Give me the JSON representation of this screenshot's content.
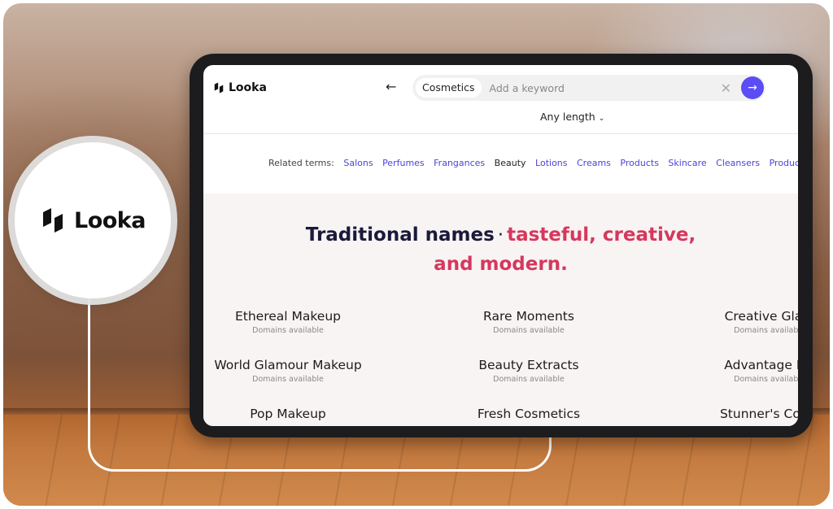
{
  "brand": {
    "name": "Looka"
  },
  "search": {
    "chip": "Cosmetics",
    "placeholder": "Add a keyword",
    "clear_icon": "close-icon",
    "submit_icon": "arrow-right-icon",
    "back_icon": "arrow-left-icon"
  },
  "filters": {
    "length": "Any length"
  },
  "related": {
    "label": "Related terms:",
    "terms": [
      "Salons",
      "Perfumes",
      "Frangances",
      "Beauty",
      "Lotions",
      "Creams",
      "Products",
      "Skincare",
      "Cleansers",
      "Product"
    ],
    "active": "Beauty"
  },
  "headline": {
    "part1": "Traditional names",
    "separator": "·",
    "part2": "tasteful, creative,",
    "part3": "and modern."
  },
  "results": {
    "col1": [
      {
        "name": "Ethereal Makeup",
        "status": "Domains available"
      },
      {
        "name": "World Glamour Makeup",
        "status": "Domains available"
      },
      {
        "name": "Pop Makeup",
        "status": ""
      }
    ],
    "col2": [
      {
        "name": "Rare Moments",
        "status": "Domains available"
      },
      {
        "name": "Beauty Extracts",
        "status": "Domains available"
      },
      {
        "name": "Fresh Cosmetics",
        "status": ""
      }
    ],
    "col3": [
      {
        "name": "Creative Glam",
        "status": "Domains available"
      },
      {
        "name": "Advantage Ma",
        "status": "Domains available"
      },
      {
        "name": "Stunner's Cosm",
        "status": ""
      }
    ]
  },
  "colors": {
    "accent": "#d6375e",
    "link": "#4b45d6",
    "button": "#5b4cf5",
    "navy": "#1a1a3a"
  }
}
